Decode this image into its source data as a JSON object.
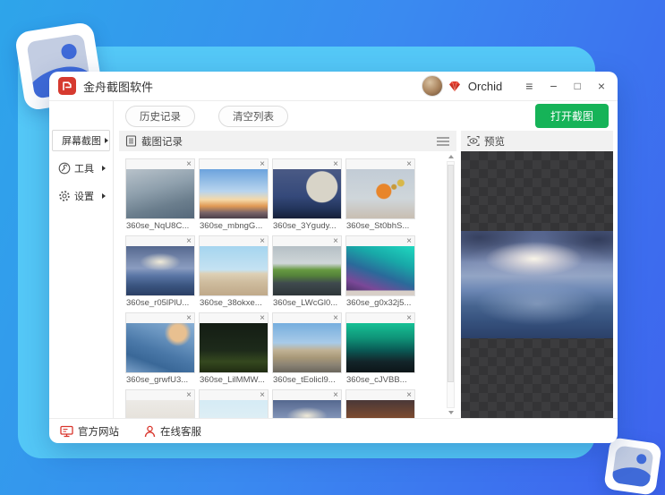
{
  "titlebar": {
    "title": "金舟截图软件",
    "username": "Orchid",
    "menu_icon": "≡",
    "minimize_icon": "−",
    "maximize_icon": "□",
    "close_icon": "×"
  },
  "toolbar": {
    "history_button": "历史记录",
    "clear_button": "清空列表",
    "open_button": "打开截图",
    "open_button_color": "#16b358"
  },
  "sidebar": {
    "items": [
      {
        "label": "屏幕截图",
        "icon": "screenshot-image-icon",
        "selected": true
      },
      {
        "label": "工具",
        "icon": "wrench-icon",
        "selected": false
      },
      {
        "label": "设置",
        "icon": "gear-icon",
        "selected": false
      }
    ]
  },
  "records_panel": {
    "title": "截图记录"
  },
  "preview_panel": {
    "title": "预览"
  },
  "gallery": {
    "close_glyph": "×",
    "items": [
      {
        "name": "360se_NqU8C...",
        "thumb": "t1"
      },
      {
        "name": "360se_mbngG...",
        "thumb": "t2"
      },
      {
        "name": "360se_3Ygudy...",
        "thumb": "t3"
      },
      {
        "name": "360se_St0bhS...",
        "thumb": "t4"
      },
      {
        "name": "360se_r05lPlU...",
        "thumb": "t5"
      },
      {
        "name": "360se_38okxe...",
        "thumb": "t6"
      },
      {
        "name": "360se_LWcGl0...",
        "thumb": "t7"
      },
      {
        "name": "360se_g0x32j5...",
        "thumb": "t8"
      },
      {
        "name": "360se_grwfU3...",
        "thumb": "t9"
      },
      {
        "name": "360se_LilMMW...",
        "thumb": "t10"
      },
      {
        "name": "360se_tEolicl9...",
        "thumb": "t11"
      },
      {
        "name": "360se_cJVBB...",
        "thumb": "t12"
      },
      {
        "name": "",
        "thumb": "t13"
      },
      {
        "name": "",
        "thumb": "t14"
      },
      {
        "name": "",
        "thumb": "t15"
      },
      {
        "name": "",
        "thumb": "t16"
      }
    ]
  },
  "footer": {
    "website": "官方网站",
    "support": "在线客服"
  }
}
